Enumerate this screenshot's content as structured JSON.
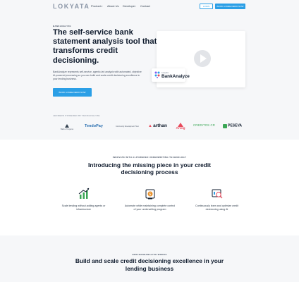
{
  "nav": {
    "logo": "LOKYATA",
    "links": [
      "Product",
      "About Us",
      "Developer",
      "Contact"
    ],
    "login_label": "LOGIN",
    "demo_label": "BOOK A FREE DEMO NOW"
  },
  "hero": {
    "eyebrow": "BANKANALYZE",
    "title": "The self-service bank statement analysis tool that transforms credit decisioning.",
    "description": "BankAnalyze represents self-service, agentic-led analysis with automated, objective AI-powered processing so you can build and scale credit decisioning excellence in your lending business.",
    "cta_label": "BOOK A FREE DEMO NOW",
    "badge_small": "Lokyata",
    "badge_name": "BankAnalyze"
  },
  "trust": {
    "label": "LENDERS POWERED BY BANKANALYZE",
    "logos": [
      "Bank of Guyana",
      "TendoPay",
      "Community Development Trust",
      "arthan",
      "Arvog",
      "CREDITOS CR",
      "PESEVA"
    ]
  },
  "section2": {
    "eyebrow": "INNOVATE WITH AI-POWERED UNDERWRITING TECHNOLOGY",
    "title": "Introducing the missing piece in your credit decisioning process",
    "features": [
      {
        "text": "Scale lending without adding agents or infrastructure"
      },
      {
        "text": "Automate while maintaining complete control of your underwriting program"
      },
      {
        "text": "Continuously learn and optimize credit decisioning using AI"
      }
    ]
  },
  "section3": {
    "eyebrow": "HOW BANKANALYZE WORKS",
    "title": "Build and scale credit decisioning excellence in your lending business"
  },
  "colors": {
    "accent": "#2b9fe6",
    "heading": "#0f1b2d",
    "hero_bg": "#f6f7f9",
    "icon_green": "#3aa655",
    "icon_orange": "#e8912b"
  }
}
